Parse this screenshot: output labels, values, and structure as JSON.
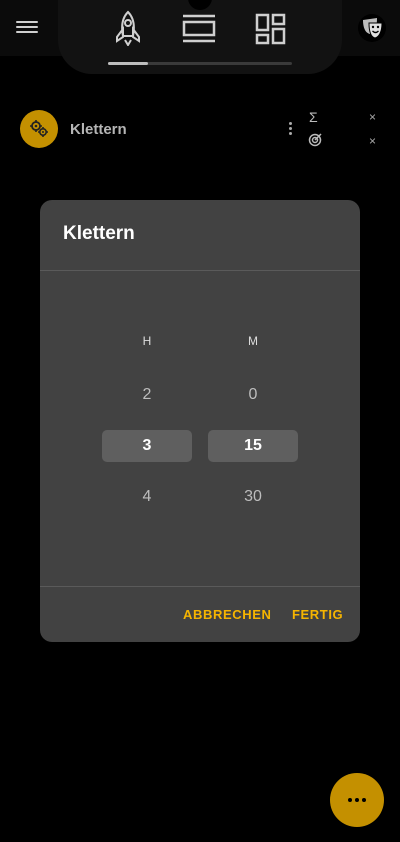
{
  "activity": {
    "name": "Klettern",
    "sigma_symbol": "Σ",
    "close_symbol": "×"
  },
  "dialog": {
    "title": "Klettern",
    "hours": {
      "label": "H",
      "above": "2",
      "selected": "3",
      "below": "4"
    },
    "minutes": {
      "label": "M",
      "above": "0",
      "selected": "15",
      "below": "30"
    },
    "cancel_label": "ABBRECHEN",
    "done_label": "FERTIG"
  },
  "progress": {
    "fraction": 0.22
  },
  "colors": {
    "accent": "#f5b400",
    "accent_dark": "#c49000",
    "dialog_bg": "#424242"
  },
  "icons": [
    "menu-icon",
    "rocket-icon",
    "view-agenda-icon",
    "dashboard-icon",
    "theater-mask-icon",
    "gear-cluster-icon",
    "more-vert-icon",
    "sigma-icon",
    "target-icon",
    "close-icon",
    "more-horiz-icon"
  ]
}
